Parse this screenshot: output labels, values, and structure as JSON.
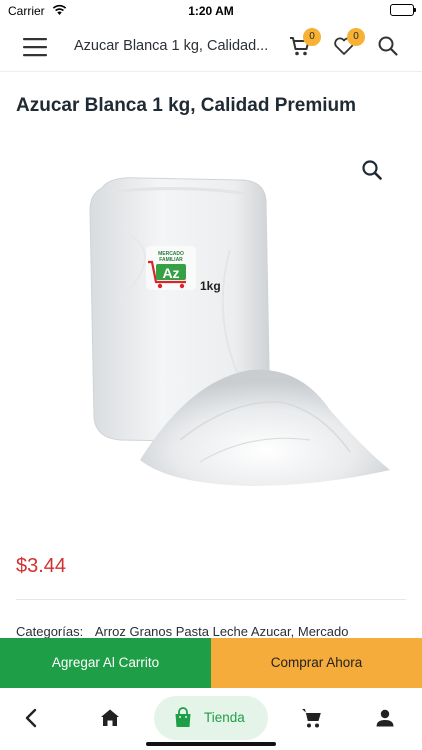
{
  "status_bar": {
    "carrier": "Carrier",
    "time": "1:20 AM"
  },
  "header": {
    "title": "Azucar Blanca 1 kg, Calidad...",
    "cart_count": "0",
    "wishlist_count": "0",
    "icons": [
      "menu-icon",
      "cart-icon",
      "heart-icon",
      "search-icon"
    ]
  },
  "product": {
    "title": "Azucar Blanca 1 kg, Calidad Premium",
    "price": "$3.44",
    "categories_label": "Categorías:",
    "categories_value": "Arroz Granos Pasta Leche Azucar, Mercado",
    "image_logo_text": {
      "line1": "MERCADO",
      "line2": "FAMILIAR",
      "brand": "Az",
      "weight": "1kg"
    }
  },
  "actions": {
    "add_to_cart": "Agregar Al Carrito",
    "buy_now": "Comprar Ahora"
  },
  "bottom_nav": {
    "items": [
      "back-icon",
      "home-icon",
      "store-icon",
      "cart-icon",
      "profile-icon"
    ],
    "active_label": "Tienda"
  },
  "colors": {
    "green": "#1e9e46",
    "orange": "#f6ac3a",
    "price_red": "#d1312f",
    "badge": "#f7b234",
    "pill_bg": "#e5f4e9"
  }
}
